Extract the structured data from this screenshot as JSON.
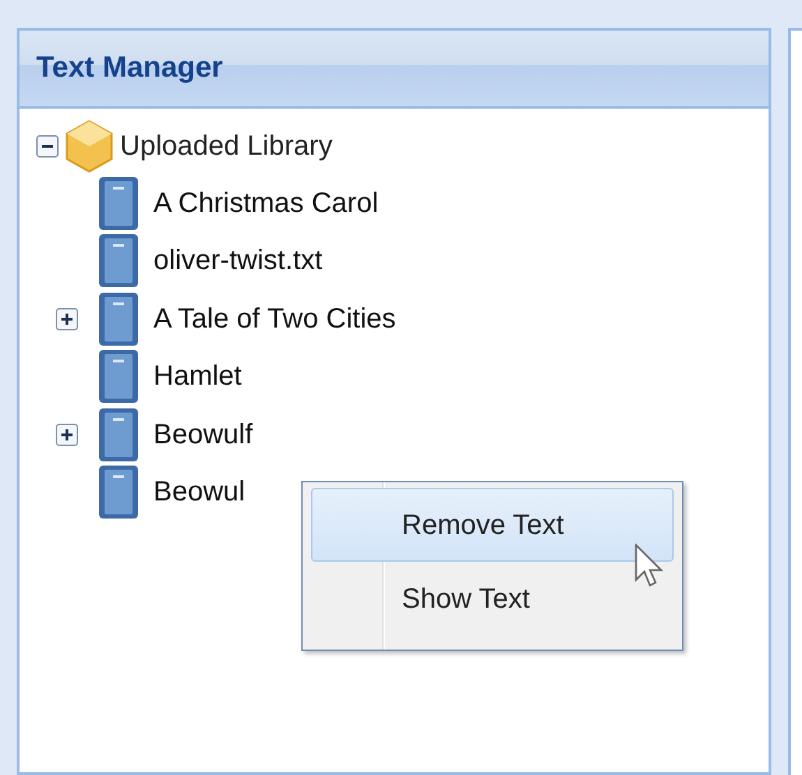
{
  "panel": {
    "title": "Text Manager"
  },
  "tree": {
    "label": "Uploaded Library",
    "expanded": true,
    "children": [
      {
        "label": "A Christmas Carol",
        "collapsed": false
      },
      {
        "label": "oliver-twist.txt",
        "collapsed": false
      },
      {
        "label": "A Tale of Two Cities",
        "collapsed": true
      },
      {
        "label": "Hamlet",
        "collapsed": false
      },
      {
        "label": "Beowulf",
        "collapsed": true
      },
      {
        "label": "Beowul",
        "collapsed": false
      }
    ]
  },
  "context_menu": {
    "items": [
      {
        "label": "Remove Text",
        "selected": true
      },
      {
        "label": "Show Text",
        "selected": false
      }
    ]
  }
}
